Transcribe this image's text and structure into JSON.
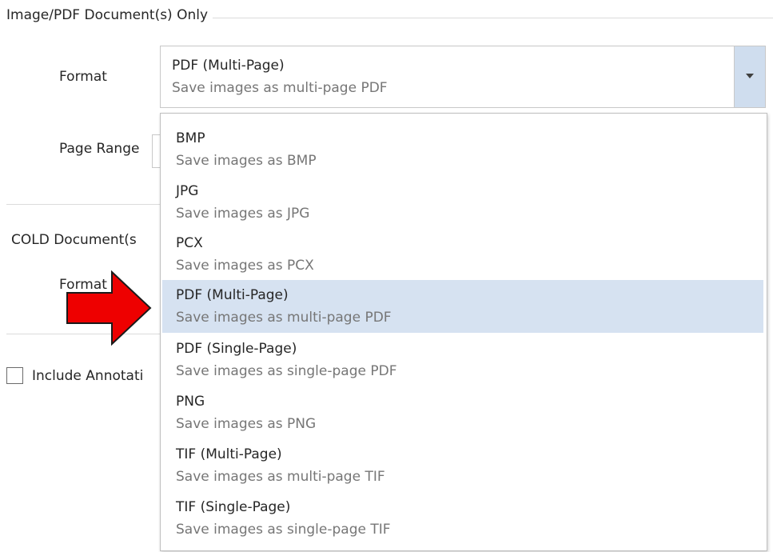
{
  "image_pdf_group": {
    "title": "Image/PDF Document(s) Only",
    "format_label": "Format",
    "page_range_label": "Page Range",
    "format_value": "PDF (Multi-Page)",
    "format_desc": "Save images as multi-page PDF"
  },
  "cold_group": {
    "title": "COLD Document(s",
    "format_label": "Format"
  },
  "annotations": {
    "label": "Include Annotati",
    "checked": false
  },
  "dropdown": {
    "options": [
      {
        "title": "BMP",
        "desc": "Save images as BMP"
      },
      {
        "title": "JPG",
        "desc": "Save images as JPG"
      },
      {
        "title": "PCX",
        "desc": "Save images as PCX"
      },
      {
        "title": "PDF (Multi-Page)",
        "desc": "Save images as multi-page PDF",
        "selected": true
      },
      {
        "title": "PDF (Single-Page)",
        "desc": "Save images as single-page PDF"
      },
      {
        "title": "PNG",
        "desc": "Save images as PNG"
      },
      {
        "title": "TIF (Multi-Page)",
        "desc": "Save images as multi-page TIF"
      },
      {
        "title": "TIF (Single-Page)",
        "desc": "Save images as single-page TIF"
      }
    ]
  },
  "colors": {
    "selected_bg": "#d6e2f1",
    "arrow_fill": "#ee0000",
    "combo_button": "#cfddee"
  },
  "icons": {
    "dropdown_arrow": "chevron-down-icon",
    "callout": "red-arrow-icon"
  }
}
